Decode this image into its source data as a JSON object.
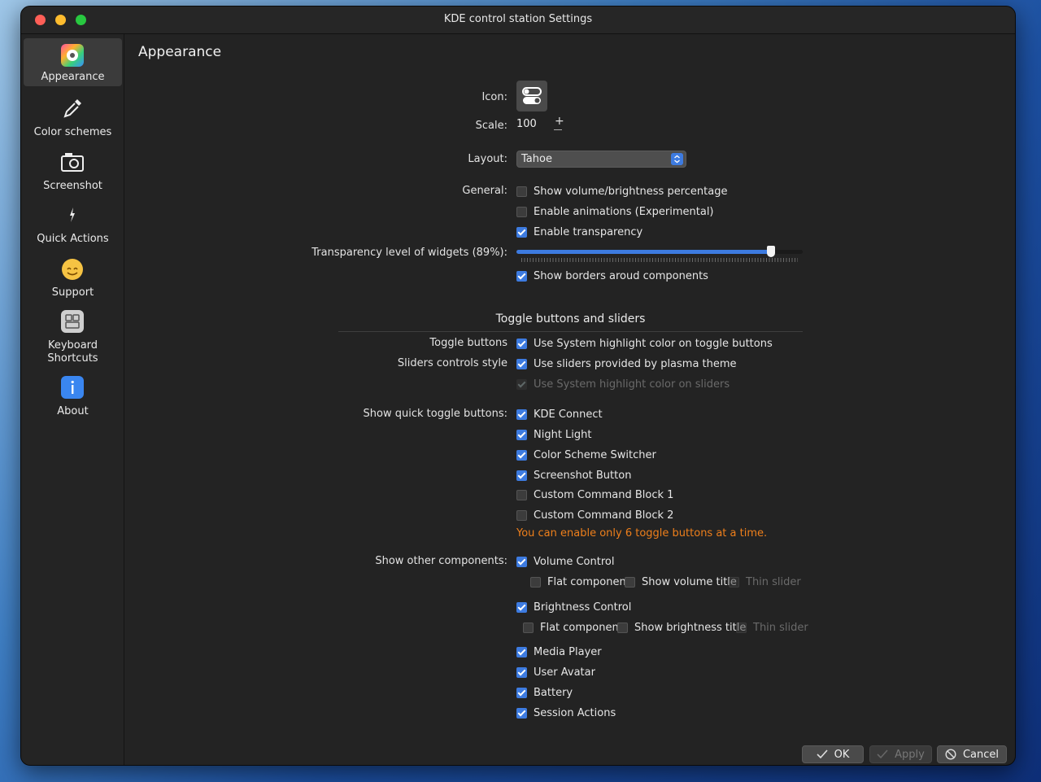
{
  "window": {
    "title": "KDE control station Settings"
  },
  "sidebar": {
    "items": [
      {
        "label": "Appearance",
        "icon": "palette-icon",
        "active": true
      },
      {
        "label": "Color schemes",
        "icon": "eyedropper-icon"
      },
      {
        "label": "Screenshot",
        "icon": "camera-icon"
      },
      {
        "label": "Quick Actions",
        "icon": "lightning-icon"
      },
      {
        "label": "Support",
        "icon": "smiley-icon"
      },
      {
        "label": "Keyboard Shortcuts",
        "icon": "keyboard-icon"
      },
      {
        "label": "About",
        "icon": "info-icon"
      }
    ]
  },
  "page": {
    "title": "Appearance"
  },
  "form": {
    "icon_label": "Icon:",
    "scale_label": "Scale:",
    "scale_value": "100",
    "layout_label": "Layout:",
    "layout_value": "Tahoe",
    "general_label": "General:",
    "general": [
      {
        "label": "Show volume/brightness percentage",
        "checked": false
      },
      {
        "label": "Enable animations (Experimental)",
        "checked": false
      },
      {
        "label": "Enable transparency",
        "checked": true
      }
    ],
    "transparency_label": "Transparency level of widgets (89%):",
    "transparency_value": 0.89,
    "borders_label": "Show borders aroud components",
    "borders_checked": true
  },
  "toggle_section": {
    "title": "Toggle buttons and sliders",
    "toggle_buttons_label": "Toggle buttons",
    "toggle_buttons_option": "Use System highlight color on toggle buttons",
    "sliders_style_label": "Sliders controls style",
    "sliders_plasma_option": "Use sliders provided by plasma theme",
    "sliders_highlight_option": "Use System highlight color on sliders"
  },
  "quick_toggles": {
    "label": "Show quick toggle buttons:",
    "items": [
      {
        "label": "KDE Connect",
        "checked": true
      },
      {
        "label": "Night Light",
        "checked": true
      },
      {
        "label": "Color Scheme Switcher",
        "checked": true
      },
      {
        "label": "Screenshot Button",
        "checked": true
      },
      {
        "label": "Custom Command Block 1",
        "checked": false
      },
      {
        "label": "Custom Command Block 2",
        "checked": false
      }
    ],
    "warning": "You can enable only 6 toggle buttons at a time."
  },
  "other_components": {
    "label": "Show other components:",
    "volume_control": "Volume Control",
    "volume_flat": "Flat component",
    "volume_title": "Show volume title",
    "volume_thin": "Thin slider",
    "brightness_control": "Brightness Control",
    "brightness_flat": "Flat component",
    "brightness_title": "Show brightness title",
    "brightness_thin": "Thin slider",
    "media_player": "Media Player",
    "user_avatar": "User Avatar",
    "battery": "Battery",
    "session_actions": "Session Actions"
  },
  "buttons": {
    "ok": "OK",
    "apply": "Apply",
    "cancel": "Cancel"
  },
  "colors": {
    "accent": "#3d7be0",
    "warning": "#ee7f1b",
    "window_bg": "#232323"
  }
}
